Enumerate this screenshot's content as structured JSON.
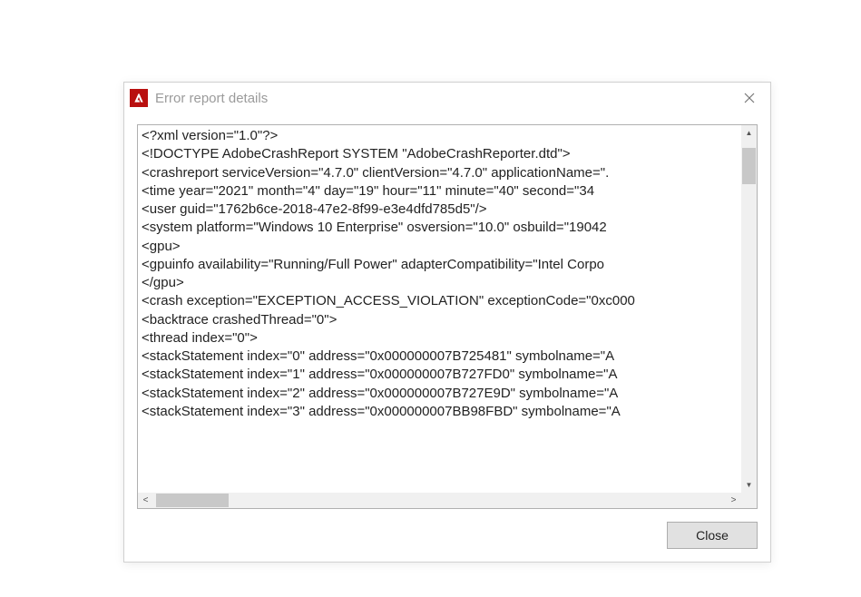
{
  "window": {
    "title": "Error report details"
  },
  "report": {
    "lines": [
      "<?xml version=\"1.0\"?>",
      "<!DOCTYPE AdobeCrashReport SYSTEM \"AdobeCrashReporter.dtd\">",
      "<crashreport serviceVersion=\"4.7.0\" clientVersion=\"4.7.0\" applicationName=\".",
      "<time year=\"2021\" month=\"4\" day=\"19\" hour=\"11\" minute=\"40\" second=\"34",
      "<user guid=\"1762b6ce-2018-47e2-8f99-e3e4dfd785d5\"/>",
      "<system platform=\"Windows 10 Enterprise\" osversion=\"10.0\" osbuild=\"19042",
      "<gpu>",
      "<gpuinfo availability=\"Running/Full Power\" adapterCompatibility=\"Intel Corpo",
      "</gpu>",
      "<crash exception=\"EXCEPTION_ACCESS_VIOLATION\" exceptionCode=\"0xc000",
      "<backtrace crashedThread=\"0\">",
      "<thread index=\"0\">",
      "<stackStatement index=\"0\" address=\"0x000000007B725481\" symbolname=\"A",
      "<stackStatement index=\"1\" address=\"0x000000007B727FD0\" symbolname=\"A",
      "<stackStatement index=\"2\" address=\"0x000000007B727E9D\" symbolname=\"A",
      "<stackStatement index=\"3\" address=\"0x000000007BB98FBD\" symbolname=\"A"
    ]
  },
  "buttons": {
    "close": "Close"
  }
}
